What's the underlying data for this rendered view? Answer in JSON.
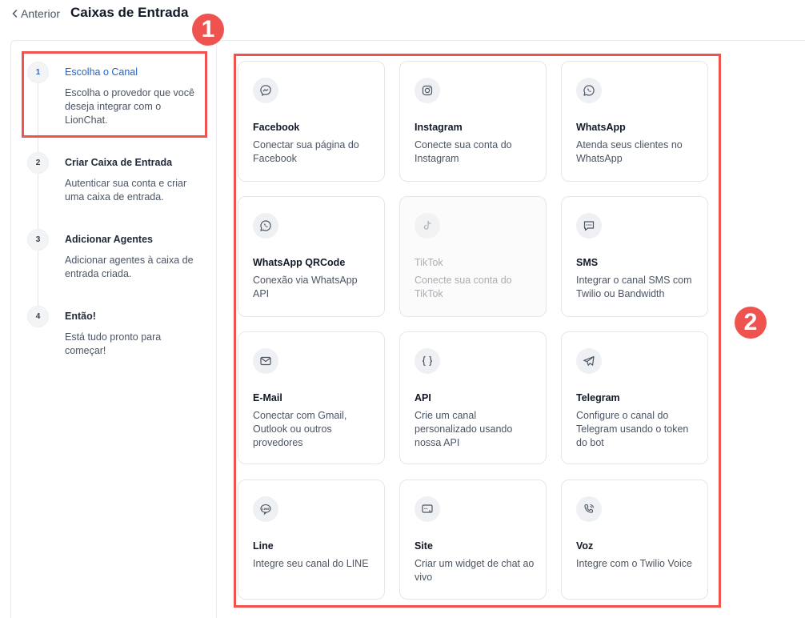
{
  "header": {
    "back_label": "Anterior",
    "title": "Caixas de Entrada"
  },
  "annotations": {
    "badge1": "1",
    "badge2": "2",
    "color": "#ef5350"
  },
  "steps": [
    {
      "num": "1",
      "title": "Escolha o Canal",
      "desc": "Escolha o provedor que você deseja integrar com o LionChat.",
      "active": true
    },
    {
      "num": "2",
      "title": "Criar Caixa de Entrada",
      "desc": "Autenticar sua conta e criar uma caixa de entrada."
    },
    {
      "num": "3",
      "title": "Adicionar Agentes",
      "desc": "Adicionar agentes à caixa de entrada criada."
    },
    {
      "num": "4",
      "title": "Então!",
      "desc": "Está tudo pronto para começar!"
    }
  ],
  "channels": [
    {
      "icon": "messenger-icon",
      "title": "Facebook",
      "desc": "Conectar sua página do Facebook"
    },
    {
      "icon": "instagram-icon",
      "title": "Instagram",
      "desc": "Conecte sua conta do Instagram"
    },
    {
      "icon": "whatsapp-icon",
      "title": "WhatsApp",
      "desc": "Atenda seus clientes no WhatsApp"
    },
    {
      "icon": "whatsapp-icon",
      "title": "WhatsApp QRCode",
      "desc": "Conexão via WhatsApp API"
    },
    {
      "icon": "tiktok-icon",
      "title": "TikTok",
      "desc": "Conecte sua conta do TikTok",
      "disabled": true
    },
    {
      "icon": "sms-icon",
      "title": "SMS",
      "desc": "Integrar o canal SMS com Twilio ou Bandwidth"
    },
    {
      "icon": "mail-icon",
      "title": "E-Mail",
      "desc": "Conectar com Gmail, Outlook ou outros provedores"
    },
    {
      "icon": "braces-icon",
      "title": "API",
      "desc": "Crie um canal personalizado usando nossa API"
    },
    {
      "icon": "telegram-icon",
      "title": "Telegram",
      "desc": "Configure o canal do Telegram usando o token do bot"
    },
    {
      "icon": "line-icon",
      "title": "Line",
      "desc": "Integre seu canal do LINE"
    },
    {
      "icon": "website-icon",
      "title": "Site",
      "desc": "Criar um widget de chat ao vivo"
    },
    {
      "icon": "voice-icon",
      "title": "Voz",
      "desc": "Integre com o Twilio Voice"
    }
  ],
  "colors": {
    "accent": "#2463c7",
    "highlight": "#ef5350",
    "border": "#e4e6ea"
  }
}
